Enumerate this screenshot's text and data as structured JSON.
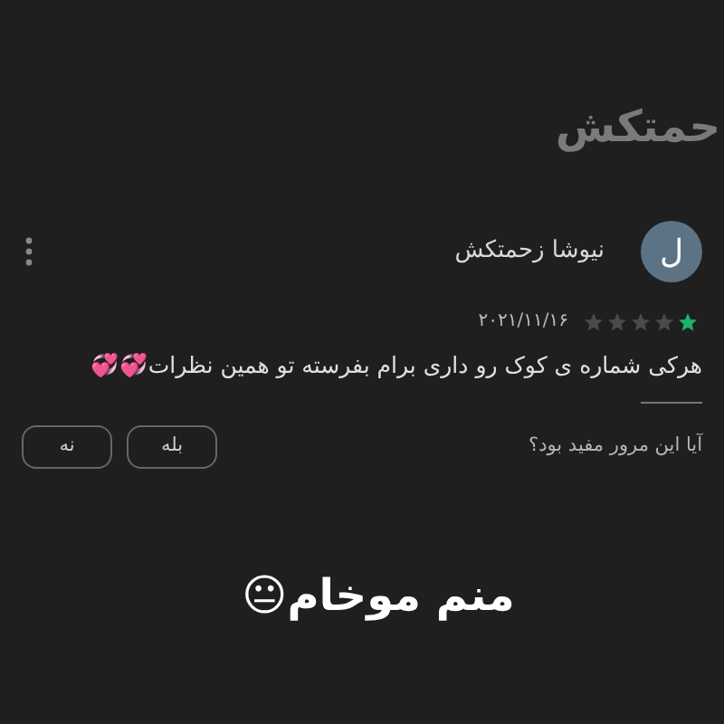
{
  "header": {
    "title": "حمتکش"
  },
  "review": {
    "avatar_letter": "ل",
    "author": "نیوشا زحمتکش",
    "stars": 1,
    "date": "۲۰۲۱/۱۱/۱۶",
    "text": "هرکی شماره ی کوک رو داری برام بفرسته تو همین نظرات💞💞"
  },
  "helpful": {
    "question": "آیا این مرور مفید بود؟",
    "buttons": [
      "بله",
      "نه"
    ]
  },
  "caption": "منم موخام😐"
}
